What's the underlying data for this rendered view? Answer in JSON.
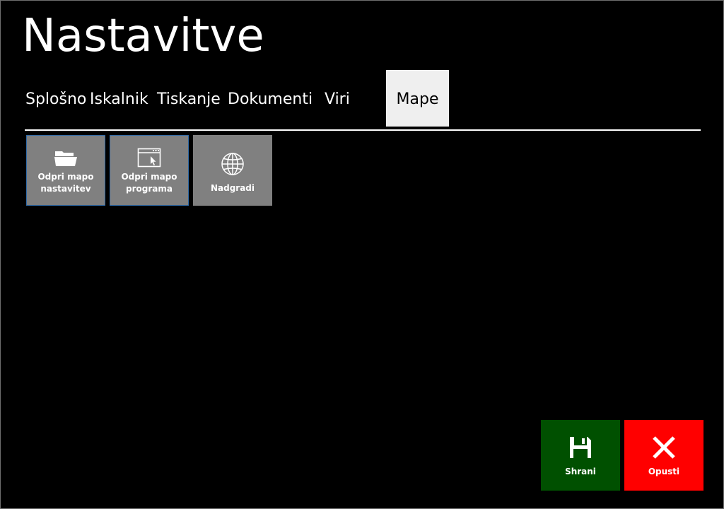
{
  "title": "Nastavitve",
  "tabs": [
    {
      "label": "Splošno"
    },
    {
      "label": "Iskalnik"
    },
    {
      "label": "Tiskanje"
    },
    {
      "label": "Dokumenti"
    },
    {
      "label": "Viri"
    },
    {
      "label": "Mape",
      "active": true
    }
  ],
  "tiles": [
    {
      "label": "Odpri mapo\nnastavitev",
      "icon": "folder-open-icon"
    },
    {
      "label": "Odpri mapo\nprograma",
      "icon": "app-window-icon"
    },
    {
      "label": "Nadgradi",
      "icon": "globe-icon"
    }
  ],
  "actions": {
    "save": {
      "label": "Shrani",
      "icon": "save-icon",
      "color": "#005000"
    },
    "cancel": {
      "label": "Opusti",
      "icon": "close-icon",
      "color": "#ff0000"
    }
  },
  "colors": {
    "background": "#000000",
    "tile": "#808080",
    "tile_border": "#2f6aa8",
    "active_tab": "#efefef"
  }
}
